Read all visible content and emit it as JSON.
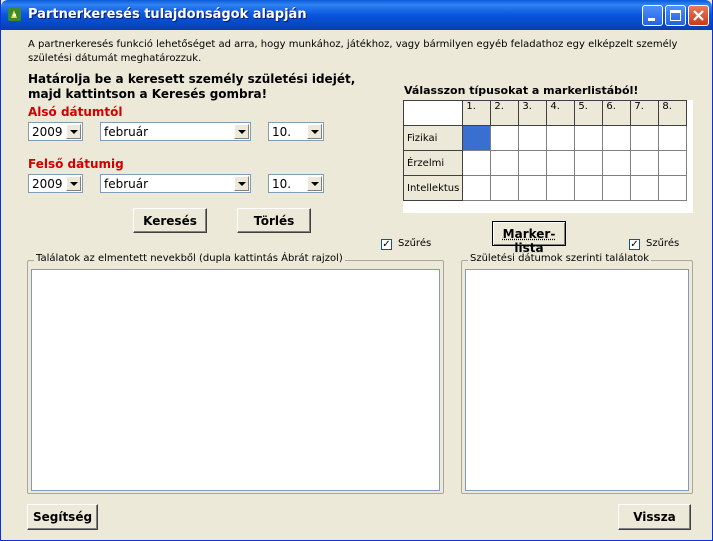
{
  "window": {
    "title": "Partnerkeresés tulajdonságok alapján"
  },
  "intro": {
    "line1": "A partnerkeresés funkció lehetőséget ad arra, hogy munkához, játékhoz, vagy bármilyen egyéb feladathoz egy elképzelt személy",
    "line2": "születési dátumát meghatározzuk."
  },
  "instruction": {
    "line1": "Határolja be a keresett személy születési idejét,",
    "line2": "majd kattintson a Keresés gombra!"
  },
  "date_from": {
    "label": "Alsó dátumtól",
    "year": "2009",
    "month": "február",
    "day": "10."
  },
  "date_to": {
    "label": "Felső dátumig",
    "year": "2009",
    "month": "február",
    "day": "10."
  },
  "buttons": {
    "search": "Keresés",
    "clear": "Törlés",
    "marker_list": "Marker-lista",
    "help": "Segítség",
    "back": "Vissza"
  },
  "marker": {
    "heading": "Válasszon típusokat a markerlistából!",
    "columns": [
      "1.",
      "2.",
      "3.",
      "4.",
      "5.",
      "6.",
      "7.",
      "8."
    ],
    "rows": [
      "Fizikai",
      "Érzelmi",
      "Intellektus"
    ],
    "selected_cell": {
      "row": 0,
      "col": 0
    }
  },
  "filter_left": {
    "label": "Szűrés",
    "checked": true
  },
  "filter_right": {
    "label": "Szűrés",
    "checked": true
  },
  "groups": {
    "saved_names": "Találatok az elmentett nevekből (dupla kattintás Ábrát rajzol)",
    "birth_dates": "Születési dátumok szerinti találatok"
  },
  "colors": {
    "titlebar": "#0855dd",
    "required_label": "#d40000",
    "selected_cell": "#3a6fd2"
  }
}
